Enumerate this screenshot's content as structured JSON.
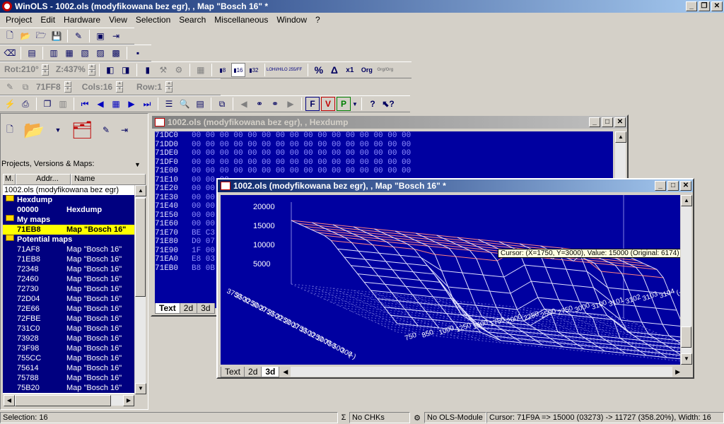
{
  "window": {
    "title": "WinOLS - 1002.ols (modyfikowana bez egr), , Map \"Bosch 16\" *"
  },
  "menu": [
    "Project",
    "Edit",
    "Hardware",
    "View",
    "Selection",
    "Search",
    "Miscellaneous",
    "Window",
    "?"
  ],
  "toolbar3": {
    "rot": "Rot:210°",
    "zoom": "Z:437%",
    "btn_percent": "%",
    "btn_delta": "Δ",
    "btn_x1": "x1",
    "btn_org": "Org",
    "btn_orgorg": "Org/Org",
    "lohi": "LOHI/HILO",
    "hex255": "255/FF"
  },
  "toolbar4": {
    "address": "71FF8",
    "cols": "Cols:16",
    "row": "Row:1"
  },
  "left_panel": {
    "label": "Projects, Versions & Maps:",
    "col_m": "M.",
    "col_addr": "Addr...",
    "col_name": "Name",
    "rows": [
      {
        "type": "plain",
        "addr": "1002.ols (modyfikowana bez egr)",
        "name": ""
      },
      {
        "type": "group",
        "addr": "Hexdump",
        "name": ""
      },
      {
        "type": "sel",
        "addr": "00000",
        "name": "Hexdump"
      },
      {
        "type": "group",
        "addr": "My maps",
        "name": ""
      },
      {
        "type": "hl",
        "addr": "71EB8",
        "name": "Map \"Bosch 16\""
      },
      {
        "type": "group",
        "addr": "Potential maps",
        "name": ""
      },
      {
        "type": "item",
        "addr": "71AF8",
        "name": "Map \"Bosch 16\""
      },
      {
        "type": "item",
        "addr": "71EB8",
        "name": "Map \"Bosch 16\""
      },
      {
        "type": "item",
        "addr": "72348",
        "name": "Map \"Bosch 16\""
      },
      {
        "type": "item",
        "addr": "72460",
        "name": "Map \"Bosch 16\""
      },
      {
        "type": "item",
        "addr": "72730",
        "name": "Map \"Bosch 16\""
      },
      {
        "type": "item",
        "addr": "72D04",
        "name": "Map \"Bosch 16\""
      },
      {
        "type": "item",
        "addr": "72E66",
        "name": "Map \"Bosch 16\""
      },
      {
        "type": "item",
        "addr": "72FBE",
        "name": "Map \"Bosch 16\""
      },
      {
        "type": "item",
        "addr": "731C0",
        "name": "Map \"Bosch 16\""
      },
      {
        "type": "item",
        "addr": "73928",
        "name": "Map \"Bosch 16\""
      },
      {
        "type": "item",
        "addr": "73F98",
        "name": "Map \"Bosch 16\""
      },
      {
        "type": "item",
        "addr": "755CC",
        "name": "Map \"Bosch 16\""
      },
      {
        "type": "item",
        "addr": "75614",
        "name": "Map \"Bosch 16\""
      },
      {
        "type": "item",
        "addr": "75788",
        "name": "Map \"Bosch 16\""
      },
      {
        "type": "item",
        "addr": "75B20",
        "name": "Map \"Bosch 16\""
      }
    ]
  },
  "hexwin": {
    "title": "1002.ols (modyfikowana bez egr), , Hexdump",
    "rows": [
      {
        "addr": "71DC0",
        "data": "00 00 00 00 00 00 00 00 00 00 00 00 00 00 00 00"
      },
      {
        "addr": "71DD0",
        "data": "00 00 00 00 00 00 00 00 00 00 00 00 00 00 00 00"
      },
      {
        "addr": "71DE0",
        "data": "00 00 00 00 00 00 00 00 00 00 00 00 00 00 00 00"
      },
      {
        "addr": "71DF0",
        "data": "00 00 00 00 00 00 00 00 00 00 00 00 00 00 00 00"
      },
      {
        "addr": "71E00",
        "data": "00 00 00 00 00 00 00 00 00 00 00 00 00 00 00 00"
      },
      {
        "addr": "71E10",
        "data": "00 00 00"
      },
      {
        "addr": "71E20",
        "data": "00 00 00"
      },
      {
        "addr": "71E30",
        "data": "00 00 00"
      },
      {
        "addr": "71E40",
        "data": "00 00 00"
      },
      {
        "addr": "71E50",
        "data": "00 00 00"
      },
      {
        "addr": "71E60",
        "data": "00 00 00"
      },
      {
        "addr": "71E70",
        "data": "BE C3"
      },
      {
        "addr": "71E80",
        "data": "D0 07"
      },
      {
        "addr": "71E90",
        "data": "1F 00"
      },
      {
        "addr": "71EA0",
        "data": "E8 03"
      },
      {
        "addr": "71EB0",
        "data": "B8 0B"
      }
    ],
    "tabs": [
      "Text",
      "2d",
      "3d"
    ]
  },
  "mapwin": {
    "title": "1002.ols (modyfikowana bez egr), , Map \"Bosch 16\" *",
    "z_ticks": [
      "20000",
      "15000",
      "10000",
      "5000"
    ],
    "y_ticks": [
      "3750",
      "3500",
      "3250",
      "3000",
      "2750",
      "2500",
      "2250",
      "2000",
      "1750",
      "1500",
      "1250",
      "1000",
      "750",
      "500",
      "300",
      "(-)"
    ],
    "x_ticks": [
      "750",
      "850",
      "1000",
      "1250",
      "1500",
      "1750",
      "2000",
      "2250",
      "2500",
      "2750",
      "3000",
      "3100",
      "3101",
      "3102",
      "3103",
      "3104",
      "(-)"
    ],
    "tooltip": "Cursor: (X=1750, Y=3000), Value: 15000 (Original: 6174)",
    "tabs": [
      "Text",
      "2d",
      "3d"
    ]
  },
  "status": {
    "selection": "Selection: 16",
    "chks": "No CHKs",
    "module": "No OLS-Module",
    "cursor": "Cursor: 71F9A => 15000 (03273) -> 11727 (358.20%), Width: 16"
  }
}
